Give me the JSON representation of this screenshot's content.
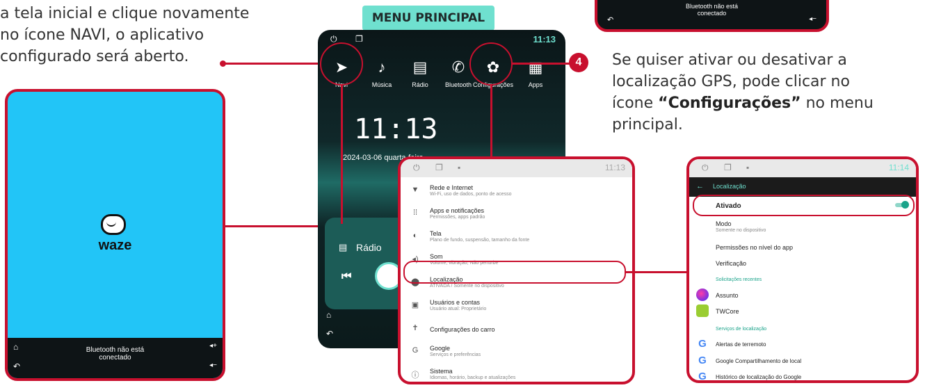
{
  "left_text": {
    "line1": "a tela inicial e clique novamente",
    "line2": "no  ícone  NAVI,  o  aplicativo",
    "line3": "configurado será aberto."
  },
  "waze_screen": {
    "logo_text": "waze",
    "bluetooth_status": "Bluetooth não está\nconectado",
    "vol_up": "◂+",
    "vol_down": "◂−"
  },
  "main_menu": {
    "title": "MENU PRINCIPAL",
    "time": "11:13",
    "apps": [
      {
        "label": "Navi",
        "glyph": "➤"
      },
      {
        "label": "Música",
        "glyph": "♪"
      },
      {
        "label": "Rádio",
        "glyph": "▤"
      },
      {
        "label": "Bluetooth",
        "glyph": "✆"
      },
      {
        "label": "Configurações",
        "glyph": "✿"
      },
      {
        "label": "Apps",
        "glyph": "▦"
      }
    ],
    "clock": "11:13",
    "date": "2024-03-06  quarta-feira",
    "radio_label": "Rádio"
  },
  "step4": {
    "number": "4",
    "line1": "Se  quiser  ativar  ou  desativar  a",
    "line2": "localização  GPS,  pode  clicar  no",
    "line3_pre": "ícone ",
    "line3_bold": "“Configurações”",
    "line3_post": " no menu",
    "line4": "principal."
  },
  "settings": {
    "time": "11:13",
    "items": [
      {
        "icon": "wifi-icon",
        "glyph": "▼",
        "title": "Rede e Internet",
        "sub": "Wi-Fi, uso de dados, ponto de acesso"
      },
      {
        "icon": "apps-icon",
        "glyph": "⁞⁞",
        "title": "Apps e notificações",
        "sub": "Permissões, apps padrão"
      },
      {
        "icon": "display-icon",
        "glyph": "◐",
        "title": "Tela",
        "sub": "Plano de fundo, suspensão, tamanho da fonte"
      },
      {
        "icon": "sound-icon",
        "glyph": "◂)",
        "title": "Som",
        "sub": "Volume, vibração, Não perturbe"
      },
      {
        "icon": "location-icon",
        "glyph": "⬤",
        "title": "Localização",
        "sub": "ATIVADA / Somente no dispositivo"
      },
      {
        "icon": "users-icon",
        "glyph": "▣",
        "title": "Usuários e contas",
        "sub": "Usuário atual: Proprietário"
      },
      {
        "icon": "car-icon",
        "glyph": "✝",
        "title": "Configurações do carro",
        "sub": ""
      },
      {
        "icon": "google-icon",
        "glyph": "G",
        "title": "Google",
        "sub": "Serviços e preferências"
      },
      {
        "icon": "info-icon",
        "glyph": "ⓘ",
        "title": "Sistema",
        "sub": "Idiomas, horário, backup e atualizações"
      }
    ]
  },
  "location": {
    "time": "11:14",
    "header": "Localização",
    "toggle_label": "Ativado",
    "toggle_on": true,
    "mode_title": "Modo",
    "mode_sub": "Somente no dispositivo",
    "perm_app": "Permissões no nível do app",
    "verify": "Verificação",
    "recent_header": "Solicitações recentes",
    "recent": [
      "Assunto",
      "TWCore"
    ],
    "services_header": "Serviços de localização",
    "services": [
      "Alertas de terremoto",
      "Google Compartilhamento de local",
      "Histórico de localização do Google"
    ]
  },
  "top_right_snippet": {
    "bluetooth_status": "Bluetooth não está\nconectado"
  },
  "colors": {
    "accent": "#c8102e",
    "waze_bg": "#22c5f7",
    "menu_title_bg": "#6fe0cf",
    "toggle": "#1aa38a",
    "settings_header": "#1b1b1b"
  }
}
